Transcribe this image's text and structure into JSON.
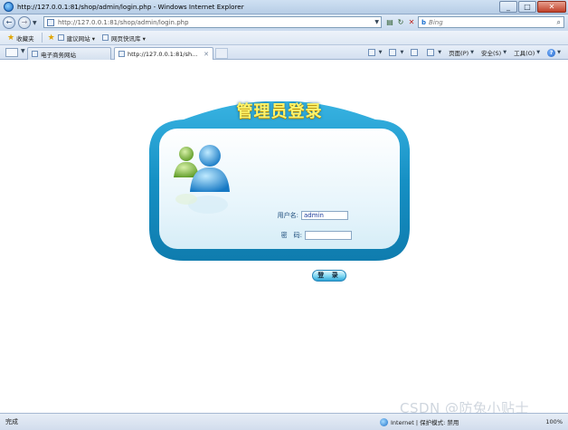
{
  "window": {
    "title": "http://127.0.0.1:81/shop/admin/login.php - Windows Internet Explorer",
    "minimize_label": "_",
    "maximize_label": "□",
    "close_label": "✕"
  },
  "address_bar": {
    "back_label": "←",
    "forward_label": "→",
    "url": "http://127.0.0.1:81/shop/admin/login.php",
    "search_engine": "Bing",
    "search_placeholder": "Bing"
  },
  "favorites_bar": {
    "favorites_label": "收藏夹",
    "items": [
      {
        "label": "建议网站 ▾"
      },
      {
        "label": "网页快讯库 ▾"
      }
    ]
  },
  "tabs": [
    {
      "label": "电子商务网站"
    },
    {
      "label": "http://127.0.0.1:81/sh...",
      "close": "✕"
    }
  ],
  "command_bar": {
    "page_label": "页面(P)",
    "safety_label": "安全(S)",
    "tools_label": "工具(O)"
  },
  "login": {
    "title": "管理员登录",
    "username_label": "用户名:",
    "username_value": "admin",
    "password_label": "密　码:",
    "password_value": "",
    "submit_label": "登 录"
  },
  "status_bar": {
    "status": "完成",
    "zone": "Internet | 保护模式: 禁用",
    "zoom": "100%"
  },
  "watermark": "CSDN @防兔小贴士",
  "colors": {
    "panel_outer": "#1690c4",
    "panel_title": "#fff36a",
    "inner_bg": "#e5f4fb"
  }
}
